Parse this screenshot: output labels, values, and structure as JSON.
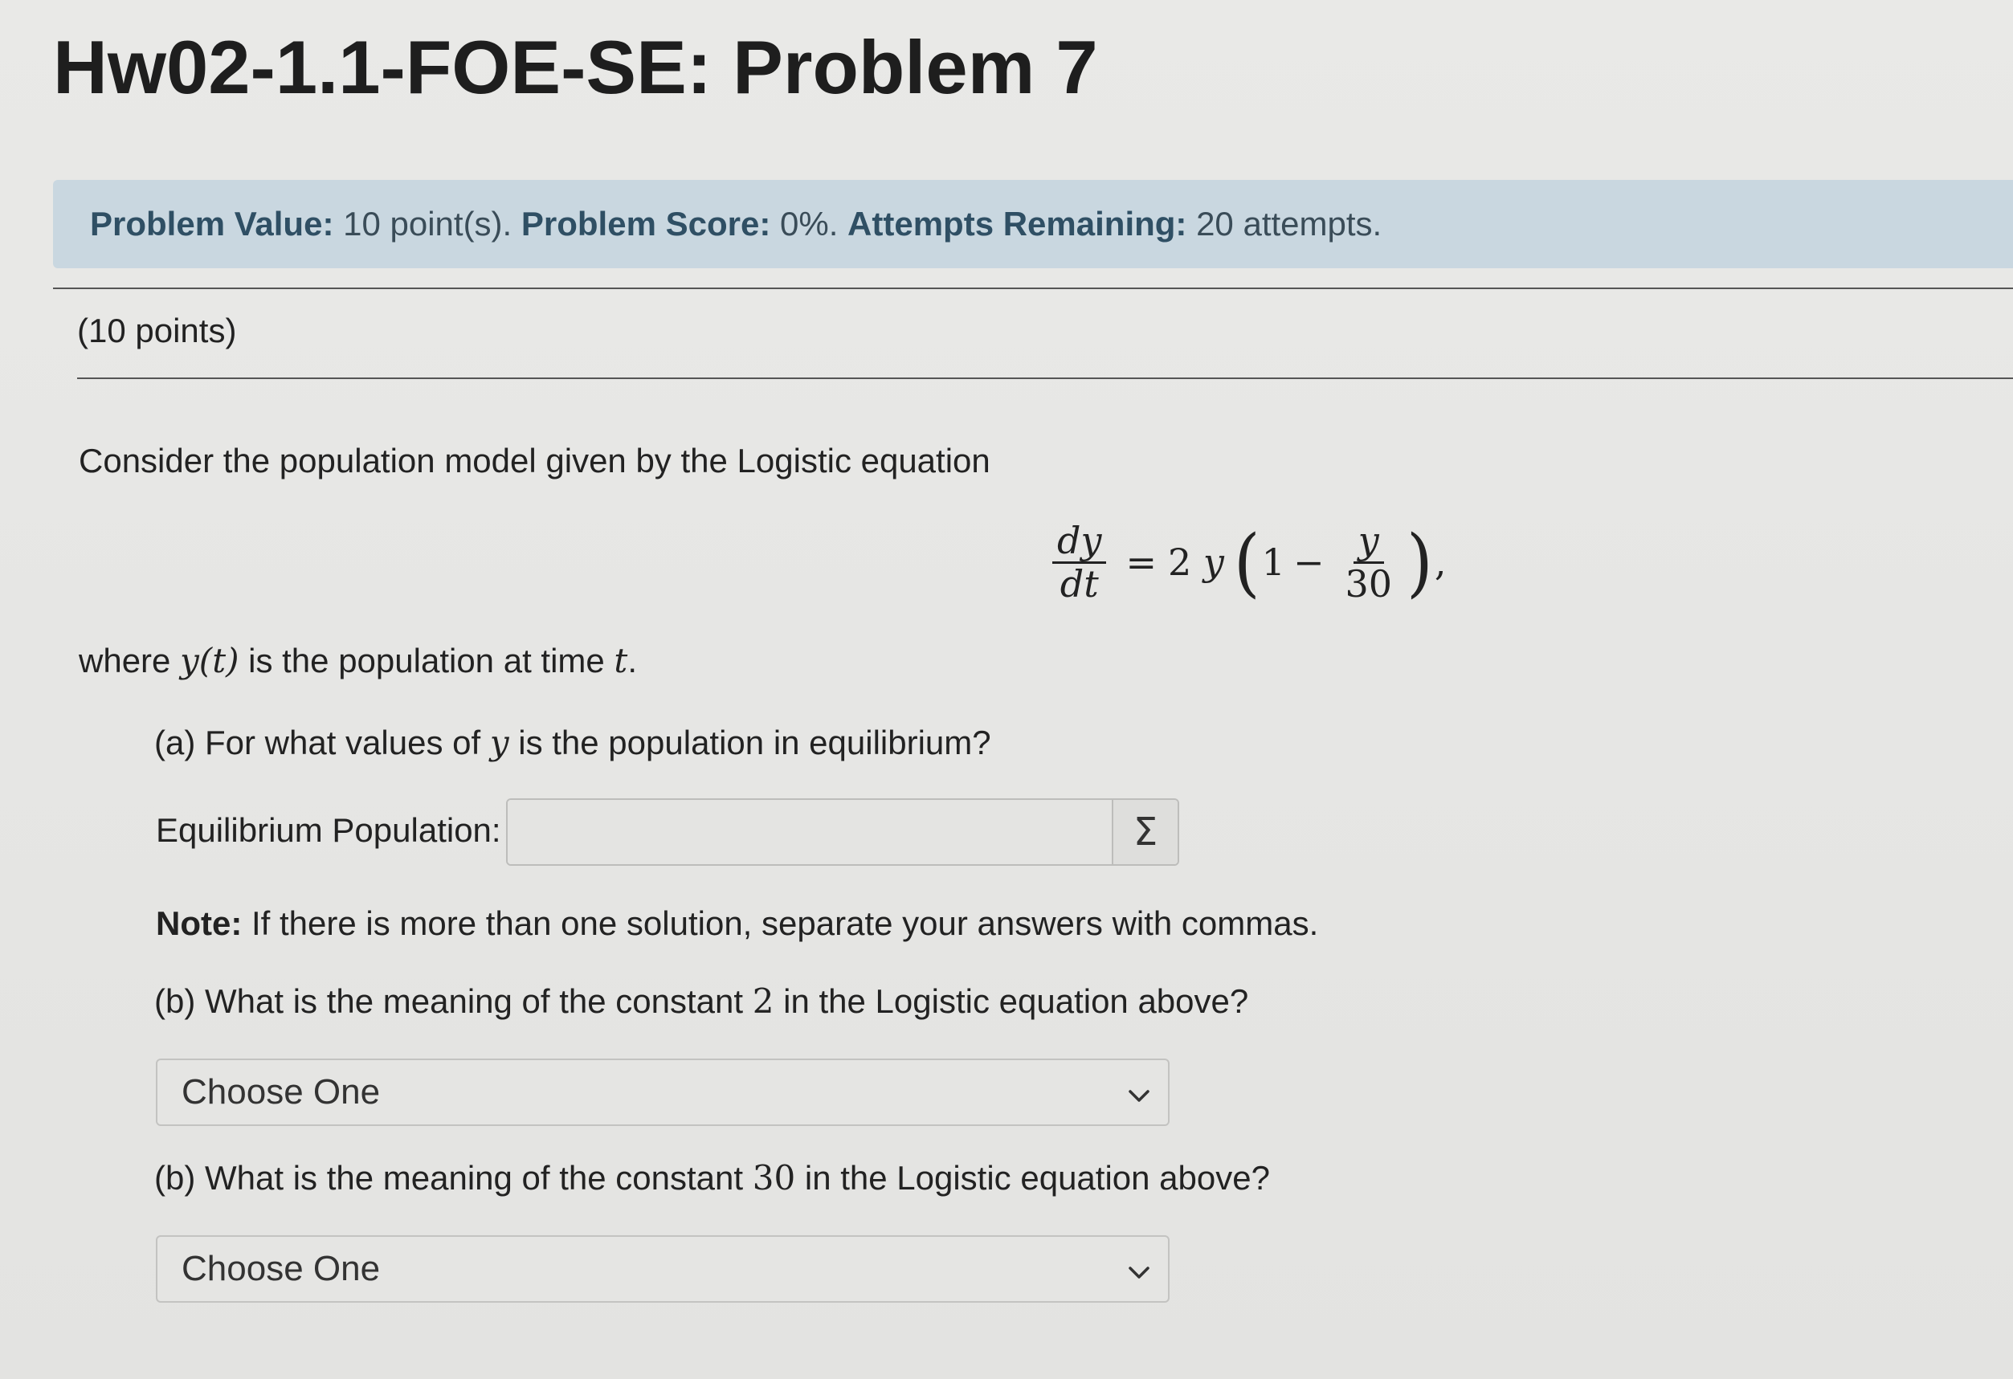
{
  "title": "Hw02-1.1-FOE-SE: Problem 7",
  "score_bar": {
    "value_label": "Problem Value:",
    "value_text": "10 point(s).",
    "score_label": "Problem Score:",
    "score_text": "0%.",
    "attempts_label": "Attempts Remaining:",
    "attempts_text": "20 attempts."
  },
  "points_text": "(10 points)",
  "intro": "Consider the population model given by the Logistic equation",
  "equation": {
    "lhs_num": "dy",
    "lhs_den": "dt",
    "equals": "=",
    "coef": "2",
    "var": "y",
    "one": "1",
    "minus": "−",
    "frac_num": "y",
    "frac_den": "30",
    "trail": ","
  },
  "where": {
    "pre": "where",
    "fn": "y(t)",
    "mid": "is the population at time",
    "t": "t",
    "end": "."
  },
  "part_a": {
    "q_pre": "(a) For what values of",
    "q_var": "y",
    "q_post": "is the population in equilibrium?",
    "input_label": "Equilibrium Population:",
    "input_value": "",
    "sigma": "Σ"
  },
  "note": {
    "label": "Note:",
    "text": "If there is more than one solution, separate your answers with commas."
  },
  "part_b1": {
    "q_pre": "(b) What is the meaning of the constant",
    "const": "2",
    "q_post": "in the Logistic equation above?",
    "select_value": "Choose One"
  },
  "part_b2": {
    "q_pre": "(b) What is the meaning of the constant",
    "const": "30",
    "q_post": "in the Logistic equation above?",
    "select_value": "Choose One"
  },
  "icons": {
    "chevron": "chevron-down-icon",
    "sigma": "sigma-icon"
  }
}
